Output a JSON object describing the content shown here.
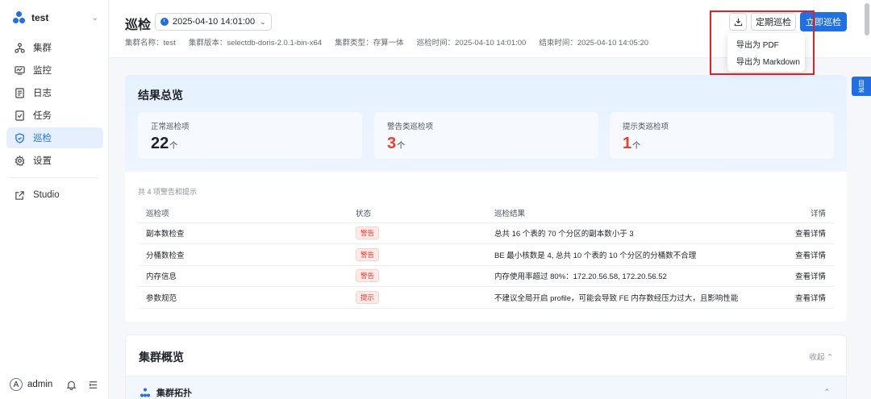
{
  "sidebar": {
    "cluster_name": "test",
    "items": [
      {
        "label": "集群",
        "icon": "cluster-icon"
      },
      {
        "label": "监控",
        "icon": "monitor-icon"
      },
      {
        "label": "日志",
        "icon": "log-icon"
      },
      {
        "label": "任务",
        "icon": "task-icon"
      },
      {
        "label": "巡检",
        "icon": "inspection-icon",
        "active": true
      },
      {
        "label": "设置",
        "icon": "gear-icon"
      }
    ],
    "studio_label": "Studio",
    "user": {
      "avatar_letter": "A",
      "name": "admin"
    }
  },
  "header": {
    "title": "巡检",
    "time_selected": "2025-04-10 14:01:00",
    "meta": {
      "cluster_name": "集群名称：test",
      "cluster_version": "集群版本：selectdb-doris-2.0.1-bin-x64",
      "cluster_type": "集群类型：存算一体",
      "inspect_time": "巡检时间：2025-04-10 14:01:00",
      "end_time": "结束时间：2025-04-10 14:05:20"
    },
    "schedule_button": "定期巡检",
    "run_button": "立即巡检",
    "export_menu": [
      "导出为 PDF",
      "导出为 Markdown"
    ],
    "toc_label": "目录"
  },
  "summary": {
    "title": "结果总览",
    "stats": [
      {
        "label": "正常巡检项",
        "value": "22",
        "unit": "个"
      },
      {
        "label": "警告类巡检项",
        "value": "3",
        "unit": "个"
      },
      {
        "label": "提示类巡检项",
        "value": "1",
        "unit": "个"
      }
    ],
    "total_text": "共 4 项警告和提示",
    "columns": [
      "巡检项",
      "状态",
      "巡检结果",
      "详情"
    ],
    "rows": [
      {
        "item": "副本数检查",
        "status": "警告",
        "result": "总共 16 个表的 70 个分区的副本数小于 3",
        "detail": "查看详情"
      },
      {
        "item": "分桶数检查",
        "status": "警告",
        "result": "BE 最小核数是 4, 总共 10 个表的 10 个分区的分桶数不合理",
        "detail": "查看详情"
      },
      {
        "item": "内存信息",
        "status": "警告",
        "result": "内存使用率超过 80%：172.20.56.58, 172.20.56.52",
        "detail": "查看详情"
      },
      {
        "item": "参数规范",
        "status": "提示",
        "result": "不建议全局开启 profile，可能会导致 FE 内存数经压力过大，且影响性能",
        "detail": "查看详情"
      }
    ]
  },
  "overview": {
    "title": "集群概览",
    "collapse_label": "收起",
    "topology_label": "集群拓扑"
  },
  "colors": {
    "accent": "#1f6fe5",
    "warning": "#f03c2a",
    "highlight_box": "#e52020"
  }
}
